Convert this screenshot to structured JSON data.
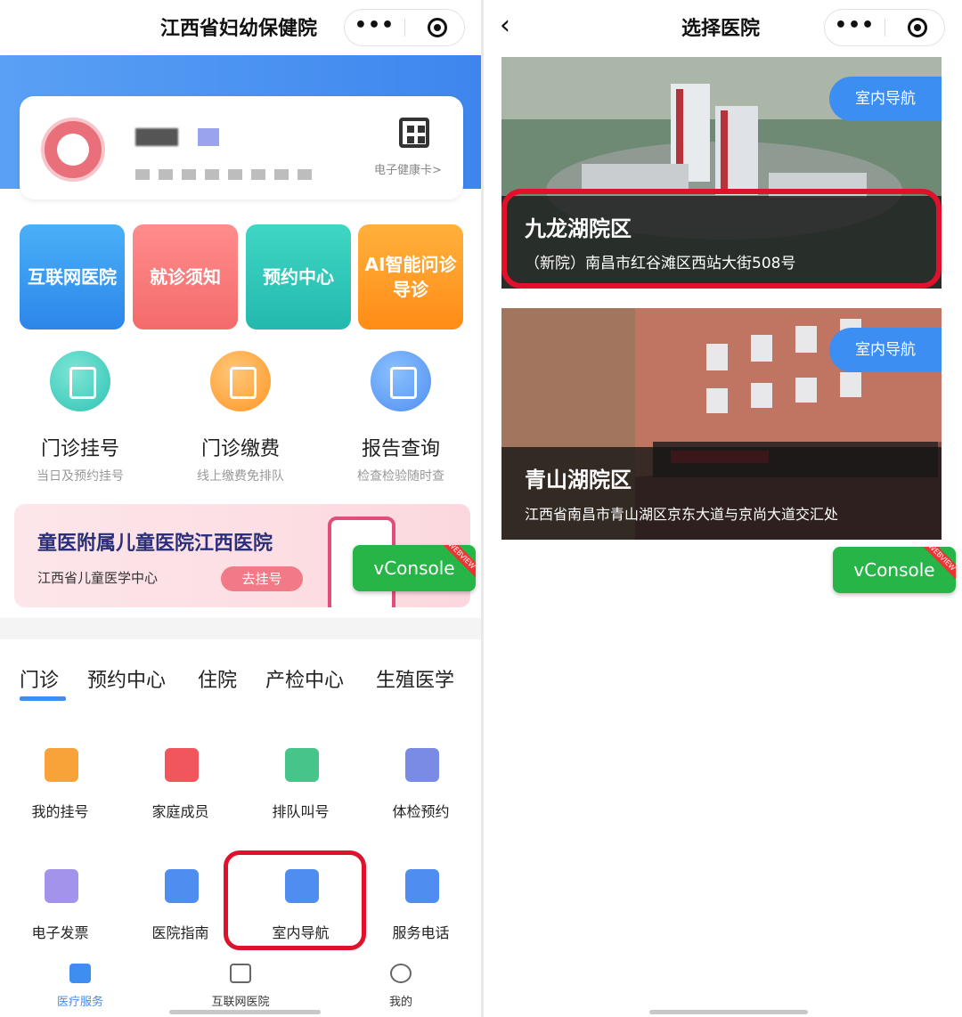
{
  "left": {
    "title": "江西省妇幼保健院",
    "capsule": {
      "more": "•••"
    },
    "profile": {
      "card_link": "电子健康卡>"
    },
    "tiles": [
      "互联网医院",
      "就诊须知",
      "预约中心",
      "AI智能问诊导诊"
    ],
    "big_services": [
      {
        "title": "门诊挂号",
        "sub": "当日及预约挂号",
        "icon": "calendar-clock-icon"
      },
      {
        "title": "门诊缴费",
        "sub": "线上缴费免排队",
        "icon": "money-bag-icon"
      },
      {
        "title": "报告查询",
        "sub": "检查检验随时查",
        "icon": "report-search-icon"
      }
    ],
    "banner": {
      "title": "童医附属儿童医院江西医院",
      "sub": "江西省儿童医学中心",
      "button": "去挂号"
    },
    "vconsole": "vConsole",
    "tabs": [
      "门诊",
      "预约中心",
      "住院",
      "产检中心",
      "生殖医学"
    ],
    "grid": [
      {
        "label": "我的挂号",
        "icon": "person-icon",
        "color": "#f8a23a"
      },
      {
        "label": "家庭成员",
        "icon": "id-card-icon",
        "color": "#f0565c"
      },
      {
        "label": "排队叫号",
        "icon": "caller-icon",
        "color": "#45c58a"
      },
      {
        "label": "体检预约",
        "icon": "fitness-icon",
        "color": "#7a8be6"
      },
      {
        "label": "电子发票",
        "icon": "invoice-icon",
        "color": "#a493ea"
      },
      {
        "label": "医院指南",
        "icon": "hospital-building-icon",
        "color": "#4f8ef0"
      },
      {
        "label": "室内导航",
        "icon": "indoor-nav-icon",
        "color": "#4f8ef0"
      },
      {
        "label": "服务电话",
        "icon": "map-pin-icon",
        "color": "#4f8ef0"
      }
    ],
    "tabbar": [
      {
        "label": "医疗服务",
        "icon": "medical-kit-icon",
        "active": true
      },
      {
        "label": "互联网医院",
        "icon": "pulse-monitor-icon",
        "active": false
      },
      {
        "label": "我的",
        "icon": "user-icon",
        "active": false
      }
    ],
    "accent": "#3e8df0"
  },
  "right": {
    "title": "选择医院",
    "capsule": {
      "more": "•••"
    },
    "hospitals": [
      {
        "name": "九龙湖院区",
        "address": "（新院）南昌市红谷滩区西站大街508号",
        "nav_button": "室内导航"
      },
      {
        "name": "青山湖院区",
        "address": "江西省南昌市青山湖区京东大道与京尚大道交汇处",
        "nav_button": "室内导航"
      }
    ],
    "vconsole": "vConsole"
  }
}
